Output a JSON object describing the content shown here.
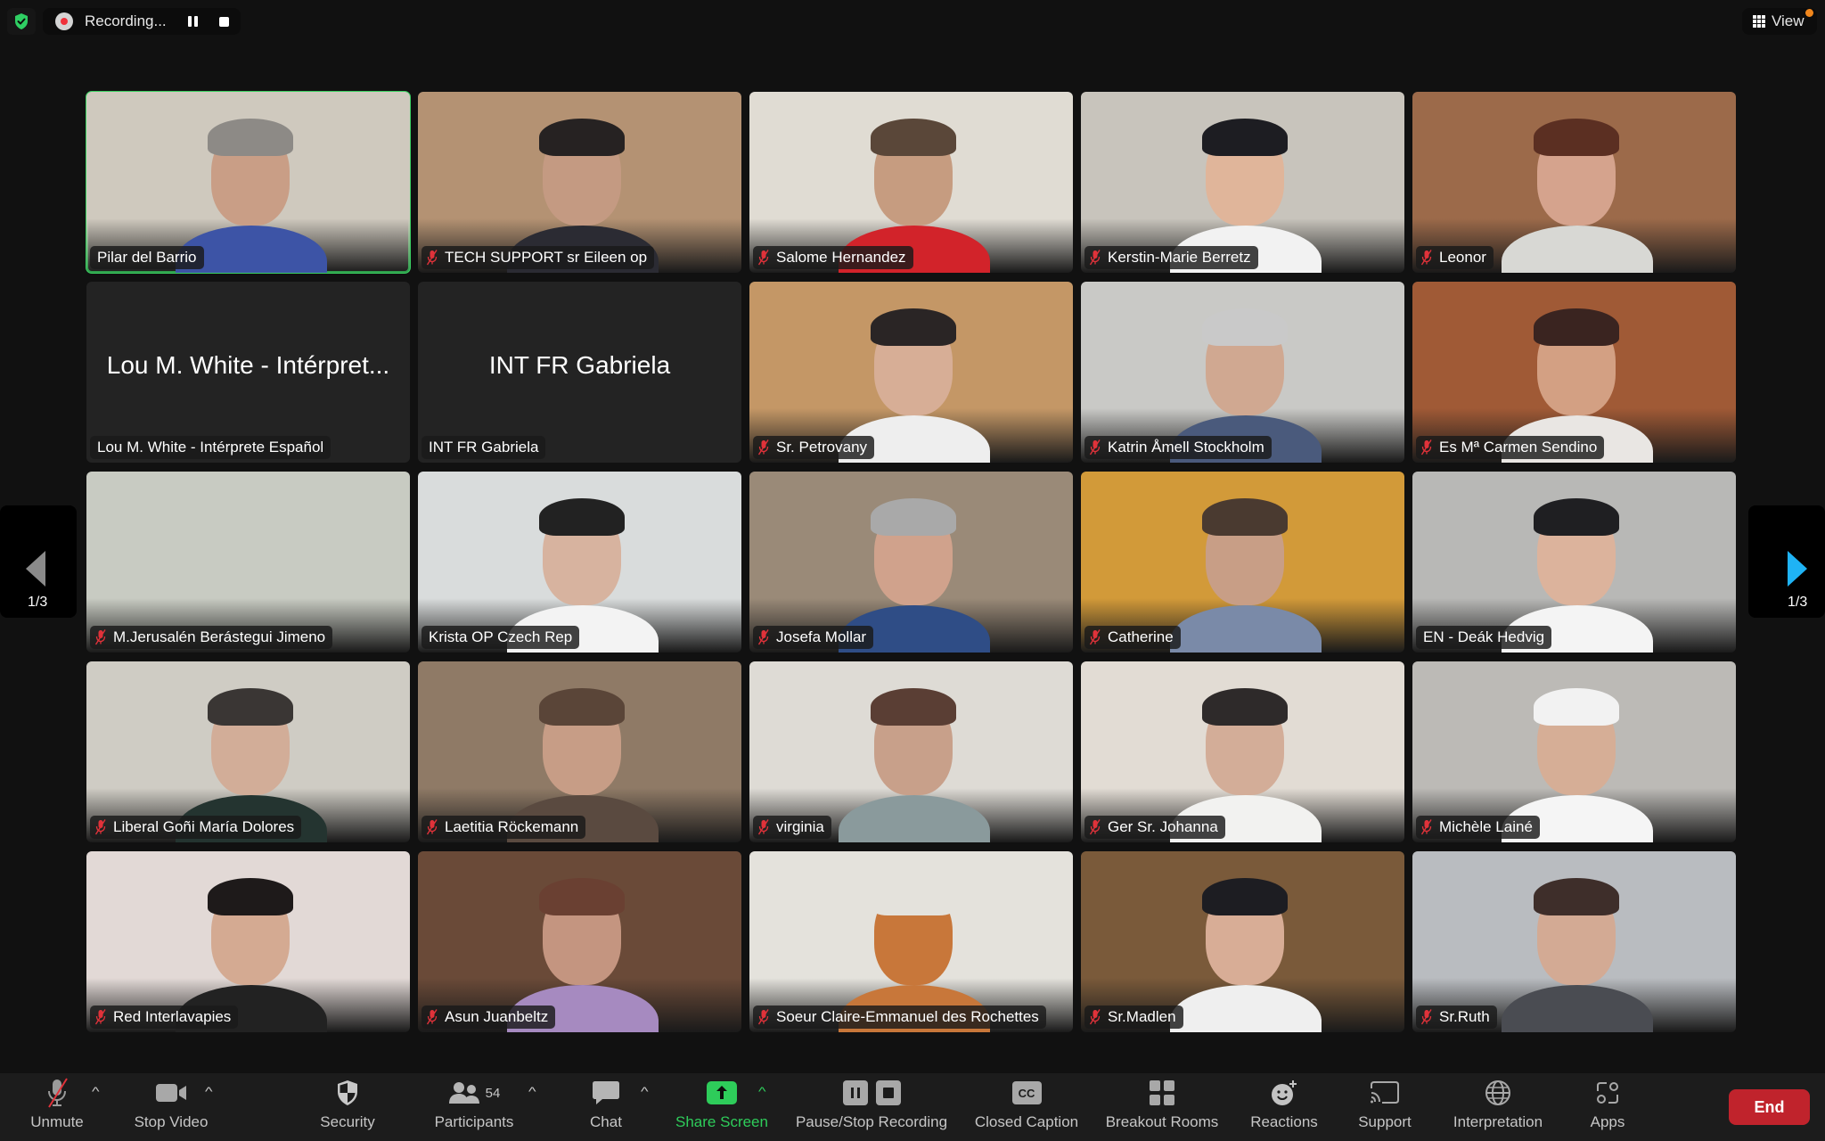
{
  "topbar": {
    "security_icon": "shield-check-icon",
    "recording_label": "Recording...",
    "view_label": "View"
  },
  "pagination": {
    "left_page": "1/3",
    "right_page": "1/3"
  },
  "participants": [
    {
      "name": "Pilar del Barrio",
      "muted": false,
      "video": true,
      "active_speaker": true,
      "bg": "#cfc9be",
      "skin": "#c99e86",
      "hair": "#8d8a86",
      "shirt": "#3d54a6"
    },
    {
      "name": "TECH SUPPORT sr Eileen op",
      "muted": true,
      "video": true,
      "bg": "#b49273",
      "skin": "#c49a82",
      "hair": "#262222",
      "shirt": "#2b2b33"
    },
    {
      "name": "Salome Hernandez",
      "muted": true,
      "video": true,
      "bg": "#e0dcd3",
      "skin": "#c69c80",
      "hair": "#5a4739",
      "shirt": "#d2232a"
    },
    {
      "name": "Kerstin-Marie Berretz",
      "muted": true,
      "video": true,
      "bg": "#c8c4bc",
      "skin": "#e0b59a",
      "hair": "#1d1d22",
      "shirt": "#f2f2f2"
    },
    {
      "name": "Leonor",
      "muted": true,
      "video": true,
      "bg": "#9c6a4a",
      "skin": "#d5a38d",
      "hair": "#5b2f22",
      "shirt": "#d8d8d4"
    },
    {
      "name": "Lou M. White - Intérprete Español",
      "display_name": "Lou M. White - Intérpret...",
      "muted": false,
      "video": false
    },
    {
      "name": "INT FR Gabriela",
      "display_name": "INT FR Gabriela",
      "muted": false,
      "video": false
    },
    {
      "name": "Sr. Petrovany",
      "muted": true,
      "video": true,
      "bg": "#c49766",
      "skin": "#d7ae96",
      "hair": "#2a2525",
      "shirt": "#eeeeee"
    },
    {
      "name": "Katrin Åmell Stockholm",
      "muted": true,
      "video": true,
      "bg": "#c9c9c6",
      "skin": "#d0a891",
      "hair": "#c9c9c9",
      "shirt": "#4a5a7c"
    },
    {
      "name": "Es Mª Carmen Sendino",
      "muted": true,
      "video": true,
      "bg": "#a05a36",
      "skin": "#d3a083",
      "hair": "#3a2420",
      "shirt": "#e9e6e3"
    },
    {
      "name": "M.Jerusalén Berástegui Jimeno",
      "muted": true,
      "video": true,
      "bg": "#c8cbc2",
      "skin": "#c8cbc2",
      "hair": "#c8cbc2",
      "shirt": "#c8cbc2",
      "empty": true
    },
    {
      "name": "Krista OP Czech Rep",
      "muted": false,
      "video": true,
      "bg": "#d9dcdc",
      "skin": "#d7b39f",
      "hair": "#222",
      "shirt": "#f3f3f3"
    },
    {
      "name": "Josefa Mollar",
      "muted": true,
      "video": true,
      "bg": "#9a8a78",
      "skin": "#d0a28c",
      "hair": "#a9a9a9",
      "shirt": "#2f4d86"
    },
    {
      "name": "Catherine",
      "muted": true,
      "video": true,
      "bg": "#d29a39",
      "skin": "#c89e86",
      "hair": "#4a3a30",
      "shirt": "#7a8aa8"
    },
    {
      "name": "EN - Deák Hedvig",
      "muted": false,
      "video": true,
      "bg": "#b8b8b6",
      "skin": "#dcb39c",
      "hair": "#1f1f22",
      "shirt": "#f4f4f4"
    },
    {
      "name": "Liberal Goñi María Dolores",
      "muted": true,
      "video": true,
      "bg": "#cfccc4",
      "skin": "#d2ad98",
      "hair": "#3a3634",
      "shirt": "#243430"
    },
    {
      "name": "Laetitia Röckemann",
      "muted": true,
      "video": true,
      "bg": "#8f7a66",
      "skin": "#c79d86",
      "hair": "#5a4538",
      "shirt": "#5a4a40"
    },
    {
      "name": "virginia",
      "muted": true,
      "video": true,
      "bg": "#dedbd5",
      "skin": "#c8a08a",
      "hair": "#5a3e34",
      "shirt": "#8a9a9c"
    },
    {
      "name": "Ger Sr. Johanna",
      "muted": true,
      "video": true,
      "bg": "#e2dcd4",
      "skin": "#d3ad98",
      "hair": "#2e2a2a",
      "shirt": "#f2f2f0"
    },
    {
      "name": "Michèle Lainé",
      "muted": true,
      "video": true,
      "bg": "#bcbab6",
      "skin": "#d6ae96",
      "hair": "#f2f2f2",
      "shirt": "#f5f5f5"
    },
    {
      "name": "Red Interlavapies",
      "muted": true,
      "video": true,
      "bg": "#e2d9d6",
      "skin": "#d4aa92",
      "hair": "#1e1a1a",
      "shirt": "#222222"
    },
    {
      "name": "Asun Juanbeltz",
      "muted": true,
      "video": true,
      "bg": "#6a4a38",
      "skin": "#c49580",
      "hair": "#6a4032",
      "shirt": "#a68ac0"
    },
    {
      "name": "Soeur Claire-Emmanuel des Rochettes",
      "muted": true,
      "video": true,
      "bg": "#e4e2dc",
      "skin": "#c8773a",
      "hair": "#e4e2dc",
      "shirt": "#c8773a"
    },
    {
      "name": "Sr.Madlen",
      "muted": true,
      "video": true,
      "bg": "#7a5a3a",
      "skin": "#d8ad96",
      "hair": "#1d1d22",
      "shirt": "#efefef"
    },
    {
      "name": "Sr.Ruth",
      "muted": true,
      "video": true,
      "bg": "#b9bcc0",
      "skin": "#d3aa94",
      "hair": "#3e2e2a",
      "shirt": "#4a4c52"
    }
  ],
  "toolbar": {
    "unmute": "Unmute",
    "stop_video": "Stop Video",
    "security": "Security",
    "participants": "Participants",
    "participants_count": "54",
    "chat": "Chat",
    "share_screen": "Share Screen",
    "pause_stop_recording": "Pause/Stop Recording",
    "closed_caption": "Closed Caption",
    "cc_glyph": "CC",
    "breakout_rooms": "Breakout Rooms",
    "reactions": "Reactions",
    "support": "Support",
    "interpretation": "Interpretation",
    "apps": "Apps",
    "end": "End"
  },
  "colors": {
    "active_speaker": "#3bd162",
    "share_screen": "#2ecc5a",
    "end_button": "#c0232c",
    "muted_icon": "#e0323a",
    "nav_active": "#1fb3f5"
  }
}
